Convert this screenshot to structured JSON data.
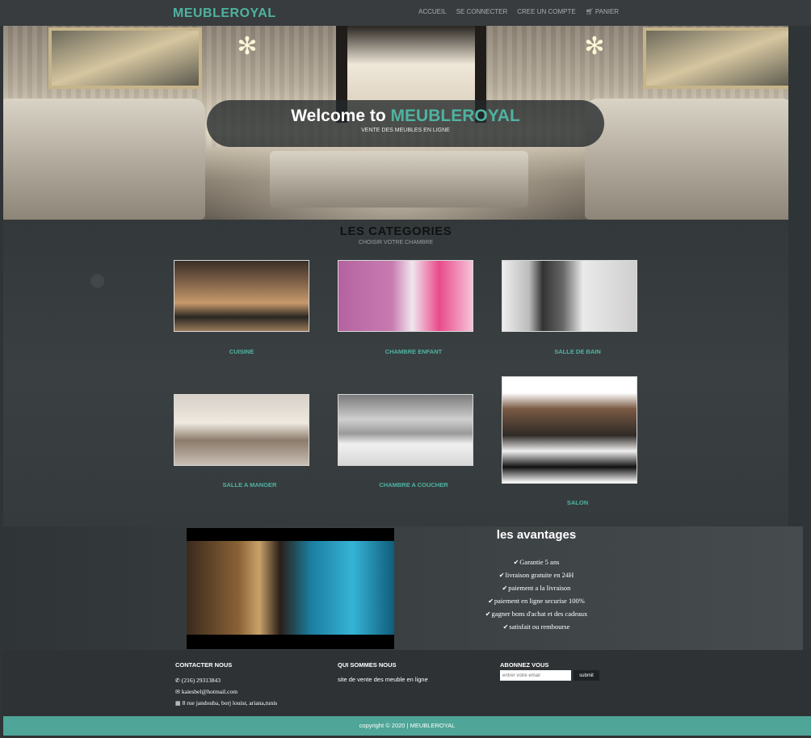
{
  "colors": {
    "accent": "#4fb3a1",
    "footer_bar": "#4fa597",
    "page_bg": "#2f3436"
  },
  "navbar": {
    "brand": "MEUBLEROYAL",
    "links": {
      "home": "ACCUEIL",
      "login": "SE CONNECTER",
      "register": "CREE UN COMPTE",
      "cart": "PANIER"
    },
    "cart_icon": "cart-icon"
  },
  "hero": {
    "title_prefix": "Welcome to",
    "title_accent": "MEUBLEROYAL",
    "subtitle": "VENTE DES MEUBLES EN LIGNE"
  },
  "categories": {
    "heading": "LES CATEGORIES",
    "subheading": "CHOISIR VOTRE CHAMBRE",
    "items": [
      {
        "label": "CUISINE"
      },
      {
        "label": "CHAMBRE ENFANT"
      },
      {
        "label": "SALLE DE BAIN"
      },
      {
        "label": "SALLE A MANGER"
      },
      {
        "label": "CHAMBRE A COUCHER"
      },
      {
        "label": "SALON"
      }
    ]
  },
  "avantages": {
    "title": "les avantages",
    "check_icon": "check-icon",
    "items": [
      "Garantie 5 ans",
      "livraison gratuite en 24H",
      "paiement a la livraison",
      "paiement en ligne securise 100%",
      "gagner bons d'achat et des cadeaux",
      "satisfait ou rembourse"
    ]
  },
  "footer": {
    "contact": {
      "title": "CONTACTER NOUS",
      "phone": "(216) 29313843",
      "email": "kaiesbel@hotmail.com",
      "address": "8 rue jandouba, borj louisr, ariana,tunis"
    },
    "about": {
      "title": "QUI SOMMES NOUS",
      "text": "site de vente des meuble en ligne"
    },
    "newsletter": {
      "title": "ABONNEZ VOUS",
      "placeholder": "entrer votre email",
      "submit": "submit"
    },
    "copyright": "copyright © 2020 | MEUBLEROYAL"
  }
}
